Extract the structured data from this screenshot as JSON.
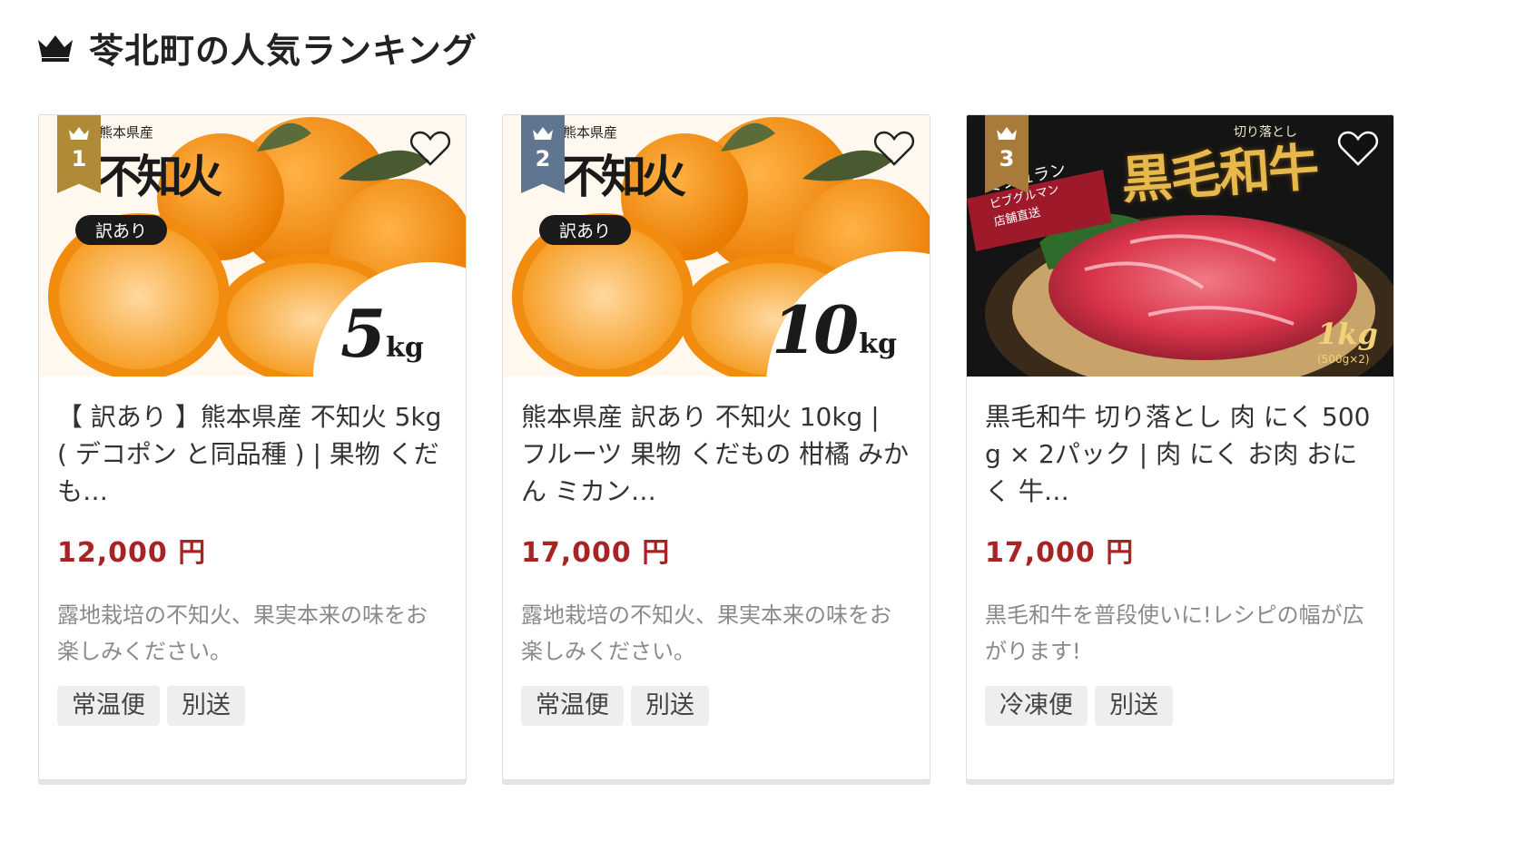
{
  "section": {
    "title": "苓北町の人気ランキング",
    "icon": "crown-icon"
  },
  "colors": {
    "price": "#a82323",
    "rank_1": "#b08a36",
    "rank_2": "#5f7590",
    "rank_3": "#a87b3a"
  },
  "products": [
    {
      "rank": "1",
      "image": {
        "region": "熊本県産",
        "name": "不知火",
        "band": "訳あり",
        "weight": "5",
        "unit": "kg"
      },
      "title": "【 訳あり 】熊本県産 不知火 5kg ( デコポン と同品種 ) | 果物 くだも…",
      "price": "12,000 円",
      "description": "露地栽培の不知火、果実本来の味をお楽しみください。",
      "tags": [
        "常温便",
        "別送"
      ]
    },
    {
      "rank": "2",
      "image": {
        "region": "熊本県産",
        "name": "不知火",
        "band": "訳あり",
        "weight": "10",
        "unit": "kg"
      },
      "title": "熊本県産 訳あり 不知火 10kg | フルーツ 果物 くだもの 柑橘 みかん ミカン…",
      "price": "17,000 円",
      "description": "露地栽培の不知火、果実本来の味をお楽しみください。",
      "tags": [
        "常温便",
        "別送"
      ]
    },
    {
      "rank": "3",
      "image": {
        "cut": "切り落とし",
        "name": "黒毛和牛",
        "ribbon_1": "ミシュラン",
        "ribbon_2": "ビブグルマン",
        "ribbon_3": "店舗直送",
        "weight": "1kg",
        "pack": "(500g×2)"
      },
      "title": "黒毛和牛 切り落とし 肉 にく 500g × 2パック | 肉 にく お肉 おにく 牛…",
      "price": "17,000 円",
      "description": "黒毛和牛を普段使いに!レシピの幅が広がります!",
      "tags": [
        "冷凍便",
        "別送"
      ]
    }
  ]
}
